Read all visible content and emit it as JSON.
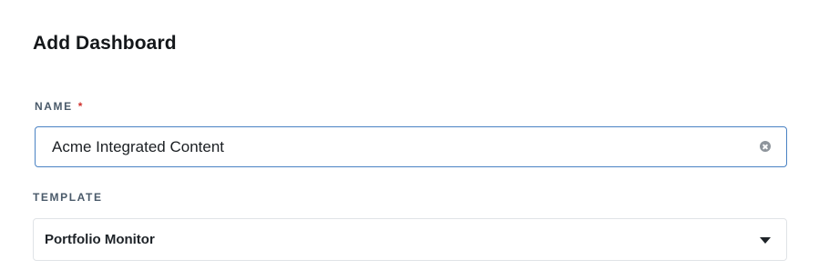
{
  "dialog": {
    "title": "Add Dashboard"
  },
  "name_field": {
    "label": "NAME",
    "required_marker": "*",
    "value": "Acme Integrated Content",
    "clear_icon": "clear-circle-icon"
  },
  "template_field": {
    "label": "TEMPLATE",
    "selected": "Portfolio Monitor",
    "dropdown_icon": "caret-down-icon"
  },
  "colors": {
    "focus_border": "#4a82c3",
    "label_text": "#4a5a6a",
    "required": "#d0312d"
  }
}
